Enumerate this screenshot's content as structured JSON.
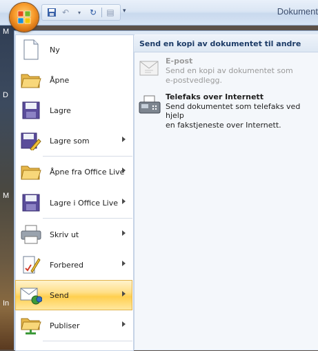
{
  "window": {
    "title": "Dokument"
  },
  "desktop": {
    "letters": [
      "M",
      "D",
      "M",
      "In"
    ]
  },
  "menu": {
    "items": [
      {
        "label": "Ny",
        "icon": "new-document-icon",
        "has_submenu": false
      },
      {
        "label": "Åpne",
        "icon": "open-folder-icon",
        "has_submenu": false
      },
      {
        "label": "Lagre",
        "icon": "save-disk-icon",
        "has_submenu": false
      },
      {
        "label": "Lagre som",
        "icon": "save-as-icon",
        "has_submenu": true
      },
      {
        "label": "Åpne fra Office Live",
        "icon": "open-folder-live-icon",
        "has_submenu": true
      },
      {
        "label": "Lagre i Office Live",
        "icon": "save-live-icon",
        "has_submenu": true
      },
      {
        "label": "Skriv ut",
        "icon": "printer-icon",
        "has_submenu": true
      },
      {
        "label": "Forbered",
        "icon": "prepare-icon",
        "has_submenu": true
      },
      {
        "label": "Send",
        "icon": "send-icon",
        "has_submenu": true,
        "active": true
      },
      {
        "label": "Publiser",
        "icon": "publish-icon",
        "has_submenu": true
      }
    ]
  },
  "submenu": {
    "heading": "Send en kopi av dokumentet til andre",
    "items": [
      {
        "title": "E-post",
        "description_lines": [
          "Send en kopi av dokumentet som",
          "e-postvedlegg."
        ],
        "enabled": false,
        "icon": "email-icon"
      },
      {
        "title": "Telefaks over Internett",
        "description_lines": [
          "Send dokumentet som telefaks ved hjelp",
          "en fakstjeneste over Internett."
        ],
        "enabled": true,
        "icon": "fax-icon"
      }
    ]
  },
  "colors": {
    "active_highlight": "#ffcf4f",
    "pane_bg": "#f4f7fb",
    "accent": "#1b3a66"
  }
}
